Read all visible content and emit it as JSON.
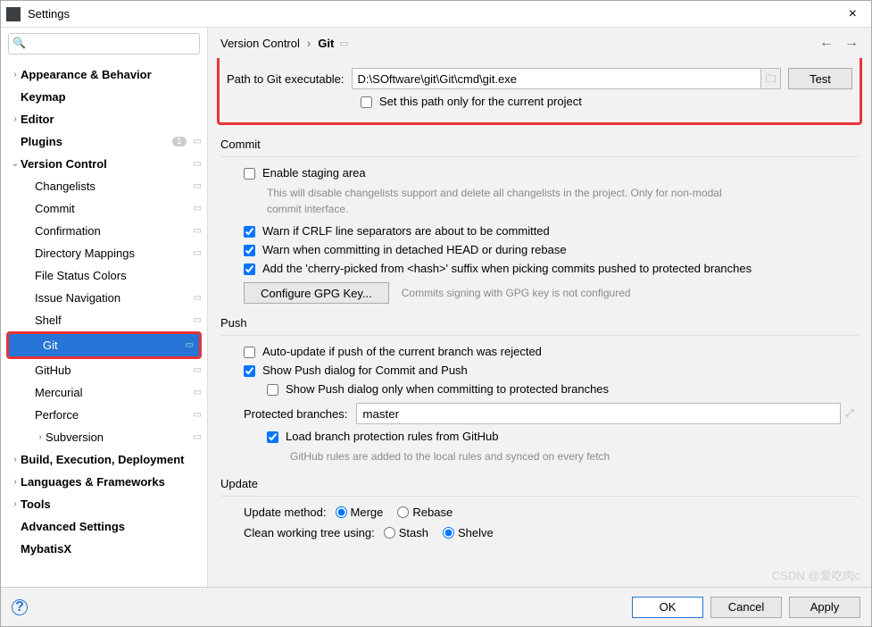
{
  "window": {
    "title": "Settings"
  },
  "search": {
    "placeholder": ""
  },
  "tree": {
    "appearance": "Appearance & Behavior",
    "keymap": "Keymap",
    "editor": "Editor",
    "plugins": "Plugins",
    "plugins_badge": "1",
    "version_control": "Version Control",
    "changelists": "Changelists",
    "commit": "Commit",
    "confirmation": "Confirmation",
    "directory_mappings": "Directory Mappings",
    "file_status_colors": "File Status Colors",
    "issue_navigation": "Issue Navigation",
    "shelf": "Shelf",
    "git": "Git",
    "github": "GitHub",
    "mercurial": "Mercurial",
    "perforce": "Perforce",
    "subversion": "Subversion",
    "build": "Build, Execution, Deployment",
    "languages": "Languages & Frameworks",
    "tools": "Tools",
    "advanced": "Advanced Settings",
    "mybatisx": "MybatisX"
  },
  "crumbs": {
    "parent": "Version Control",
    "current": "Git"
  },
  "git_path": {
    "label": "Path to Git executable:",
    "value": "D:\\SOftware\\git\\Git\\cmd\\git.exe",
    "test": "Test",
    "only_current": "Set this path only for the current project"
  },
  "commit": {
    "title": "Commit",
    "enable_staging": "Enable staging area",
    "staging_hint": "This will disable changelists support and delete all changelists in the project. Only for non-modal commit interface.",
    "warn_crlf": "Warn if CRLF line separators are about to be committed",
    "warn_detached": "Warn when committing in detached HEAD or during rebase",
    "cherry_pick": "Add the 'cherry-picked from <hash>' suffix when picking commits pushed to protected branches",
    "gpg_btn": "Configure GPG Key...",
    "gpg_hint": "Commits signing with GPG key is not configured"
  },
  "push": {
    "title": "Push",
    "auto_update": "Auto-update if push of the current branch was rejected",
    "show_dialog": "Show Push dialog for Commit and Push",
    "show_dialog_protected": "Show Push dialog only when committing to protected branches",
    "protected_label": "Protected branches:",
    "protected_value": "master",
    "load_rules": "Load branch protection rules from GitHub",
    "load_rules_hint": "GitHub rules are added to the local rules and synced on every fetch"
  },
  "update": {
    "title": "Update",
    "method_label": "Update method:",
    "merge": "Merge",
    "rebase": "Rebase",
    "clean_label": "Clean working tree using:",
    "stash": "Stash",
    "shelve": "Shelve"
  },
  "footer": {
    "ok": "OK",
    "cancel": "Cancel",
    "apply": "Apply"
  },
  "watermark": "CSDN @爱吃肉c"
}
